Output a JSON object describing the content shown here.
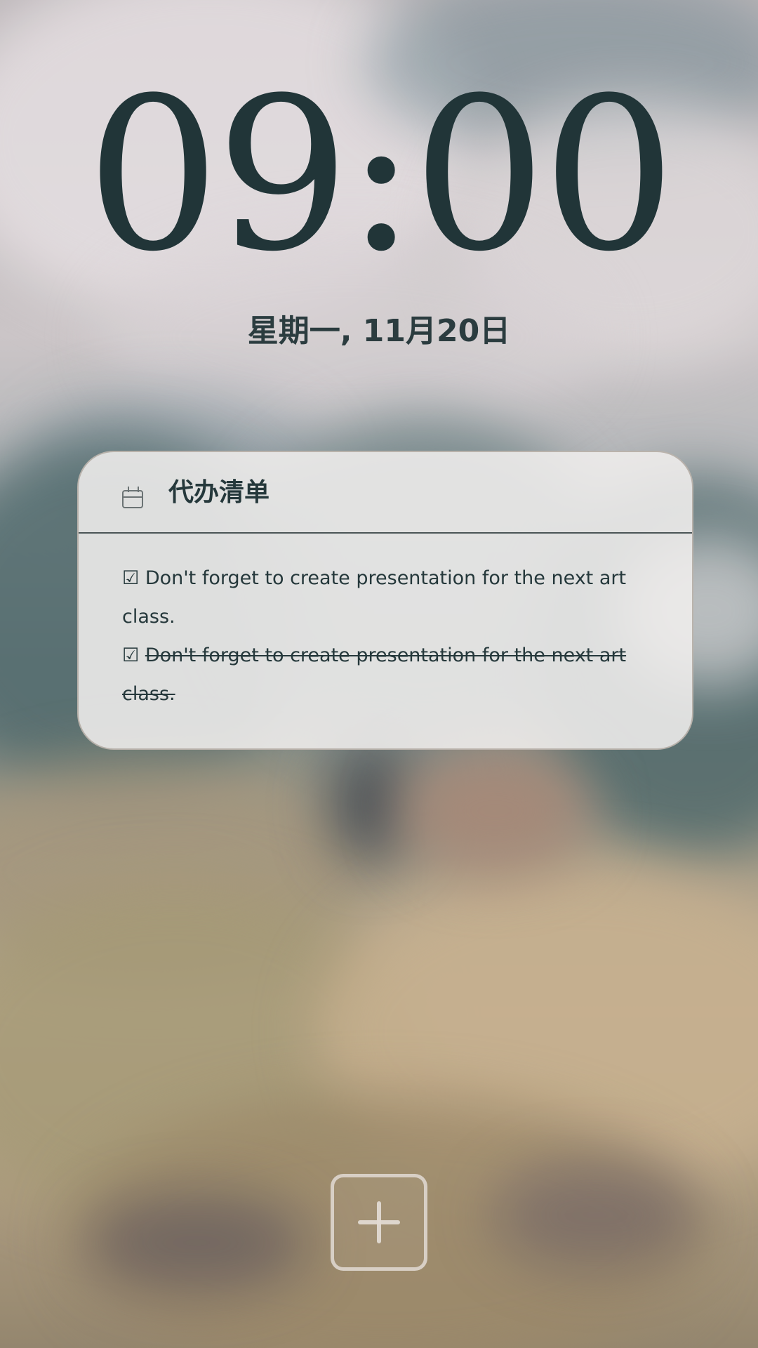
{
  "clock": {
    "time": "09:00"
  },
  "date": {
    "text": "星期一, 11月20日"
  },
  "todo_card": {
    "title": "代办清单",
    "icon": "calendar-icon",
    "items": [
      {
        "check": "☑",
        "text": "Don't forget to create presentation for the next art class.",
        "completed": false
      },
      {
        "check": "☑",
        "text": "Don't forget to create presentation for the next art class.",
        "completed": true
      }
    ]
  },
  "add_button": {
    "icon": "plus-icon"
  },
  "colors": {
    "text": "#25383b",
    "card_bg": "#f0eeed",
    "add_button": "#ded6ce"
  }
}
